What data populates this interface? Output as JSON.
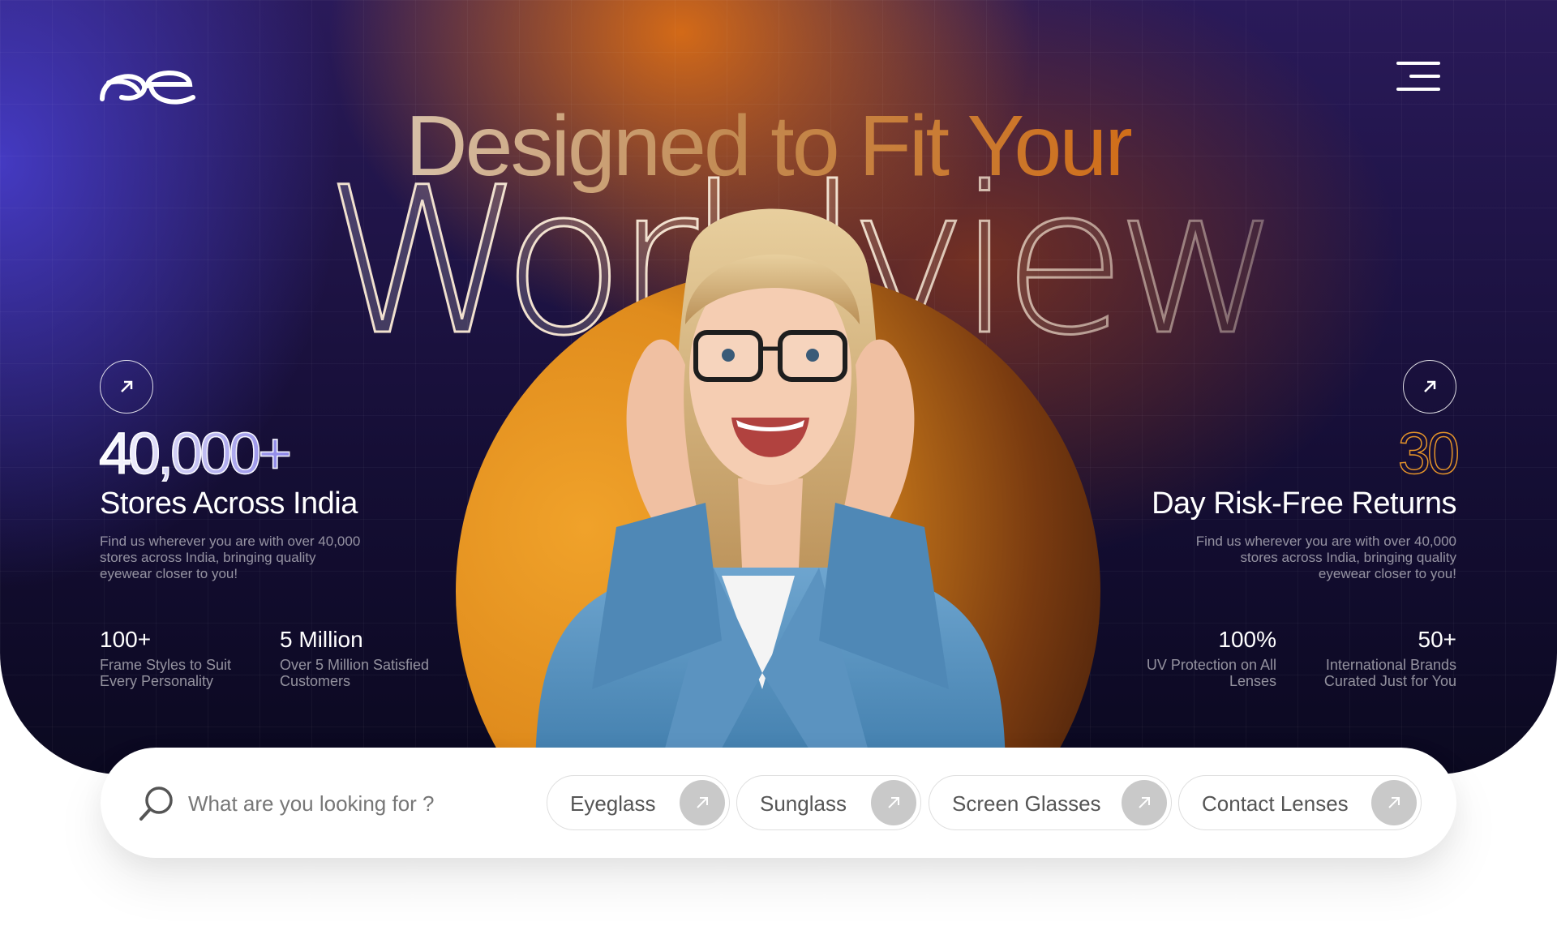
{
  "brand": {
    "logo_text": "se"
  },
  "hero": {
    "headline": "Designed to Fit Your",
    "big_word": "Worldview"
  },
  "left_stat": {
    "number": "40,000+",
    "title": "Stores Across India",
    "description": "Find us wherever you are with over 40,000 stores across India, bringing quality eyewear closer to you!",
    "mini": [
      {
        "value": "100+",
        "caption": "Frame Styles to Suit Every Personality"
      },
      {
        "value": "5 Million",
        "caption": "Over 5 Million Satisfied Customers"
      }
    ]
  },
  "right_stat": {
    "number": "30",
    "title": "Day Risk-Free Returns",
    "description": "Find us wherever you are with over 40,000 stores across India, bringing quality eyewear closer to you!",
    "mini": [
      {
        "value": "100%",
        "caption": "UV Protection on All Lenses"
      },
      {
        "value": "50+",
        "caption": "International Brands Curated Just for You"
      }
    ]
  },
  "search": {
    "placeholder": "What are you looking for ?",
    "chips": [
      "Eyeglass",
      "Sunglass",
      "Screen Glasses",
      "Contact Lenses"
    ]
  },
  "colors": {
    "accent_orange": "#e08c1d",
    "hero_purple": "#4a3cc8",
    "hero_dark": "#0b0920"
  },
  "icons": [
    "logo-icon",
    "menu-icon",
    "arrow-up-right-icon",
    "search-icon"
  ]
}
